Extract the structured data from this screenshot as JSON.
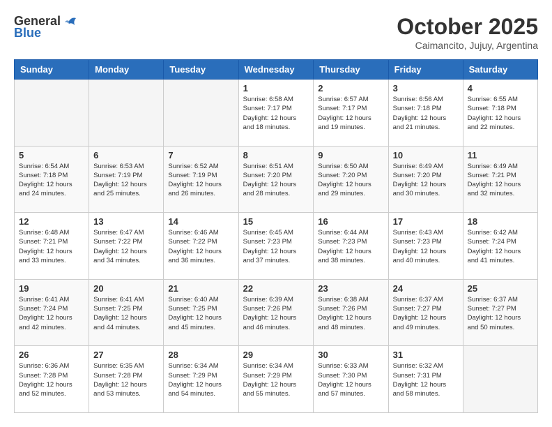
{
  "logo": {
    "general": "General",
    "blue": "Blue"
  },
  "header": {
    "month": "October 2025",
    "location": "Caimancito, Jujuy, Argentina"
  },
  "weekdays": [
    "Sunday",
    "Monday",
    "Tuesday",
    "Wednesday",
    "Thursday",
    "Friday",
    "Saturday"
  ],
  "weeks": [
    [
      {
        "day": "",
        "sunrise": "",
        "sunset": "",
        "daylight": ""
      },
      {
        "day": "",
        "sunrise": "",
        "sunset": "",
        "daylight": ""
      },
      {
        "day": "",
        "sunrise": "",
        "sunset": "",
        "daylight": ""
      },
      {
        "day": "1",
        "sunrise": "Sunrise: 6:58 AM",
        "sunset": "Sunset: 7:17 PM",
        "daylight": "Daylight: 12 hours and 18 minutes."
      },
      {
        "day": "2",
        "sunrise": "Sunrise: 6:57 AM",
        "sunset": "Sunset: 7:17 PM",
        "daylight": "Daylight: 12 hours and 19 minutes."
      },
      {
        "day": "3",
        "sunrise": "Sunrise: 6:56 AM",
        "sunset": "Sunset: 7:18 PM",
        "daylight": "Daylight: 12 hours and 21 minutes."
      },
      {
        "day": "4",
        "sunrise": "Sunrise: 6:55 AM",
        "sunset": "Sunset: 7:18 PM",
        "daylight": "Daylight: 12 hours and 22 minutes."
      }
    ],
    [
      {
        "day": "5",
        "sunrise": "Sunrise: 6:54 AM",
        "sunset": "Sunset: 7:18 PM",
        "daylight": "Daylight: 12 hours and 24 minutes."
      },
      {
        "day": "6",
        "sunrise": "Sunrise: 6:53 AM",
        "sunset": "Sunset: 7:19 PM",
        "daylight": "Daylight: 12 hours and 25 minutes."
      },
      {
        "day": "7",
        "sunrise": "Sunrise: 6:52 AM",
        "sunset": "Sunset: 7:19 PM",
        "daylight": "Daylight: 12 hours and 26 minutes."
      },
      {
        "day": "8",
        "sunrise": "Sunrise: 6:51 AM",
        "sunset": "Sunset: 7:20 PM",
        "daylight": "Daylight: 12 hours and 28 minutes."
      },
      {
        "day": "9",
        "sunrise": "Sunrise: 6:50 AM",
        "sunset": "Sunset: 7:20 PM",
        "daylight": "Daylight: 12 hours and 29 minutes."
      },
      {
        "day": "10",
        "sunrise": "Sunrise: 6:49 AM",
        "sunset": "Sunset: 7:20 PM",
        "daylight": "Daylight: 12 hours and 30 minutes."
      },
      {
        "day": "11",
        "sunrise": "Sunrise: 6:49 AM",
        "sunset": "Sunset: 7:21 PM",
        "daylight": "Daylight: 12 hours and 32 minutes."
      }
    ],
    [
      {
        "day": "12",
        "sunrise": "Sunrise: 6:48 AM",
        "sunset": "Sunset: 7:21 PM",
        "daylight": "Daylight: 12 hours and 33 minutes."
      },
      {
        "day": "13",
        "sunrise": "Sunrise: 6:47 AM",
        "sunset": "Sunset: 7:22 PM",
        "daylight": "Daylight: 12 hours and 34 minutes."
      },
      {
        "day": "14",
        "sunrise": "Sunrise: 6:46 AM",
        "sunset": "Sunset: 7:22 PM",
        "daylight": "Daylight: 12 hours and 36 minutes."
      },
      {
        "day": "15",
        "sunrise": "Sunrise: 6:45 AM",
        "sunset": "Sunset: 7:23 PM",
        "daylight": "Daylight: 12 hours and 37 minutes."
      },
      {
        "day": "16",
        "sunrise": "Sunrise: 6:44 AM",
        "sunset": "Sunset: 7:23 PM",
        "daylight": "Daylight: 12 hours and 38 minutes."
      },
      {
        "day": "17",
        "sunrise": "Sunrise: 6:43 AM",
        "sunset": "Sunset: 7:23 PM",
        "daylight": "Daylight: 12 hours and 40 minutes."
      },
      {
        "day": "18",
        "sunrise": "Sunrise: 6:42 AM",
        "sunset": "Sunset: 7:24 PM",
        "daylight": "Daylight: 12 hours and 41 minutes."
      }
    ],
    [
      {
        "day": "19",
        "sunrise": "Sunrise: 6:41 AM",
        "sunset": "Sunset: 7:24 PM",
        "daylight": "Daylight: 12 hours and 42 minutes."
      },
      {
        "day": "20",
        "sunrise": "Sunrise: 6:41 AM",
        "sunset": "Sunset: 7:25 PM",
        "daylight": "Daylight: 12 hours and 44 minutes."
      },
      {
        "day": "21",
        "sunrise": "Sunrise: 6:40 AM",
        "sunset": "Sunset: 7:25 PM",
        "daylight": "Daylight: 12 hours and 45 minutes."
      },
      {
        "day": "22",
        "sunrise": "Sunrise: 6:39 AM",
        "sunset": "Sunset: 7:26 PM",
        "daylight": "Daylight: 12 hours and 46 minutes."
      },
      {
        "day": "23",
        "sunrise": "Sunrise: 6:38 AM",
        "sunset": "Sunset: 7:26 PM",
        "daylight": "Daylight: 12 hours and 48 minutes."
      },
      {
        "day": "24",
        "sunrise": "Sunrise: 6:37 AM",
        "sunset": "Sunset: 7:27 PM",
        "daylight": "Daylight: 12 hours and 49 minutes."
      },
      {
        "day": "25",
        "sunrise": "Sunrise: 6:37 AM",
        "sunset": "Sunset: 7:27 PM",
        "daylight": "Daylight: 12 hours and 50 minutes."
      }
    ],
    [
      {
        "day": "26",
        "sunrise": "Sunrise: 6:36 AM",
        "sunset": "Sunset: 7:28 PM",
        "daylight": "Daylight: 12 hours and 52 minutes."
      },
      {
        "day": "27",
        "sunrise": "Sunrise: 6:35 AM",
        "sunset": "Sunset: 7:28 PM",
        "daylight": "Daylight: 12 hours and 53 minutes."
      },
      {
        "day": "28",
        "sunrise": "Sunrise: 6:34 AM",
        "sunset": "Sunset: 7:29 PM",
        "daylight": "Daylight: 12 hours and 54 minutes."
      },
      {
        "day": "29",
        "sunrise": "Sunrise: 6:34 AM",
        "sunset": "Sunset: 7:29 PM",
        "daylight": "Daylight: 12 hours and 55 minutes."
      },
      {
        "day": "30",
        "sunrise": "Sunrise: 6:33 AM",
        "sunset": "Sunset: 7:30 PM",
        "daylight": "Daylight: 12 hours and 57 minutes."
      },
      {
        "day": "31",
        "sunrise": "Sunrise: 6:32 AM",
        "sunset": "Sunset: 7:31 PM",
        "daylight": "Daylight: 12 hours and 58 minutes."
      },
      {
        "day": "",
        "sunrise": "",
        "sunset": "",
        "daylight": ""
      }
    ]
  ]
}
